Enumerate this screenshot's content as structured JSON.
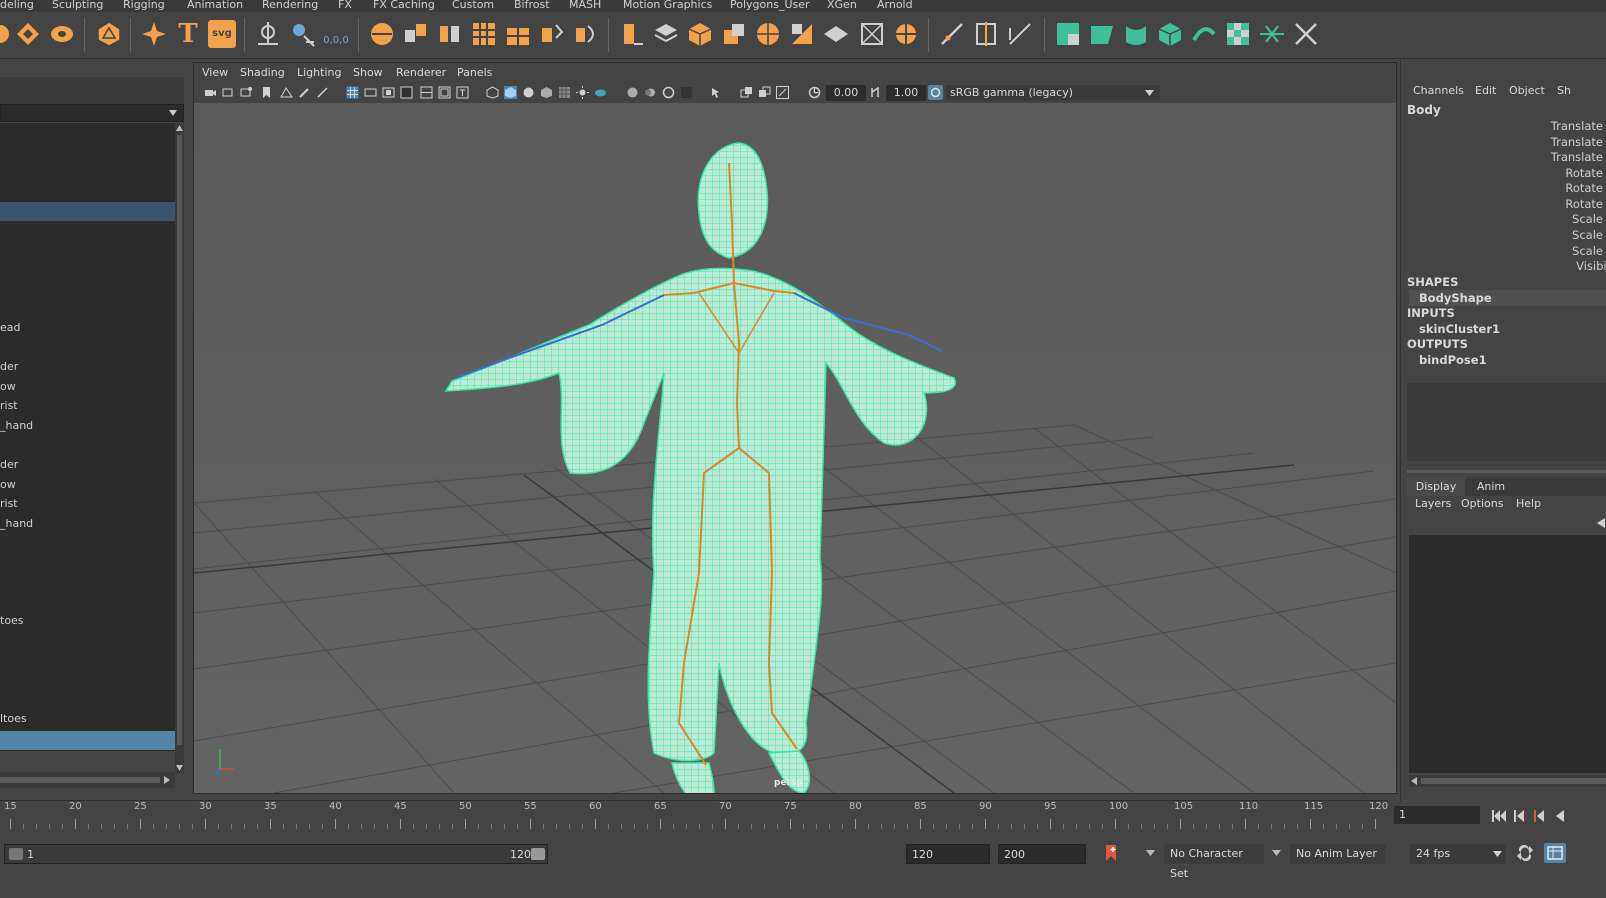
{
  "shelf_tabs": [
    "deling",
    "Sculpting",
    "Rigging",
    "Animation",
    "Rendering",
    "FX",
    "FX Caching",
    "Custom",
    "Bifrost",
    "MASH",
    "Motion Graphics",
    "Polygons_User",
    "XGen",
    "Arnold"
  ],
  "shelf_icons": {
    "text_tool": "T",
    "svg_tool": "svg",
    "snap_origin_label": "0,0,0"
  },
  "outliner": {
    "items": [
      "ead",
      "der",
      "ow",
      "rist",
      "_hand",
      "der",
      "ow",
      "rist",
      "_hand",
      "toes",
      "ltoes"
    ]
  },
  "viewport": {
    "menu": [
      "View",
      "Shading",
      "Lighting",
      "Show",
      "Renderer",
      "Panels"
    ],
    "exposure_value": "0.00",
    "gamma_value": "1.00",
    "color_space": "sRGB gamma (legacy)",
    "camera_label": "persp"
  },
  "channel_box": {
    "menu": [
      "Channels",
      "Edit",
      "Object",
      "Sh"
    ],
    "object_name": "Body",
    "attributes": [
      "Translate",
      "Translate",
      "Translate",
      "Rotate",
      "Rotate",
      "Rotate",
      "Scale",
      "Scale",
      "Scale",
      "Visibili"
    ],
    "shapes_header": "SHAPES",
    "shape_node": "BodyShape",
    "inputs_header": "INPUTS",
    "input_node": "skinCluster1",
    "outputs_header": "OUTPUTS",
    "output_node": "bindPose1"
  },
  "layer_editor": {
    "tabs": [
      "Display",
      "Anim"
    ],
    "menu": [
      "Layers",
      "Options",
      "Help"
    ]
  },
  "time_slider": {
    "ticks": [
      "15",
      "20",
      "25",
      "30",
      "35",
      "40",
      "45",
      "50",
      "55",
      "60",
      "65",
      "70",
      "75",
      "80",
      "85",
      "90",
      "95",
      "100",
      "105",
      "110",
      "115",
      "120"
    ],
    "current_frame": "1"
  },
  "range_bar": {
    "range_start": "1",
    "range_end_inner": "120",
    "anim_end": "120",
    "playback_end": "200",
    "character_set": "No Character Set",
    "anim_layer": "No Anim Layer",
    "fps": "24 fps"
  },
  "colors": {
    "selection_blue": "#5285a6",
    "selection_dark": "#3d5470",
    "mesh_green": "#4ef0b0",
    "joint_orange": "#d88a2a",
    "joint_blue": "#3a6fd0",
    "shelf_orange": "#f2a24a",
    "shelf_green": "#3fbf9a",
    "key_red": "#e05a3a"
  }
}
